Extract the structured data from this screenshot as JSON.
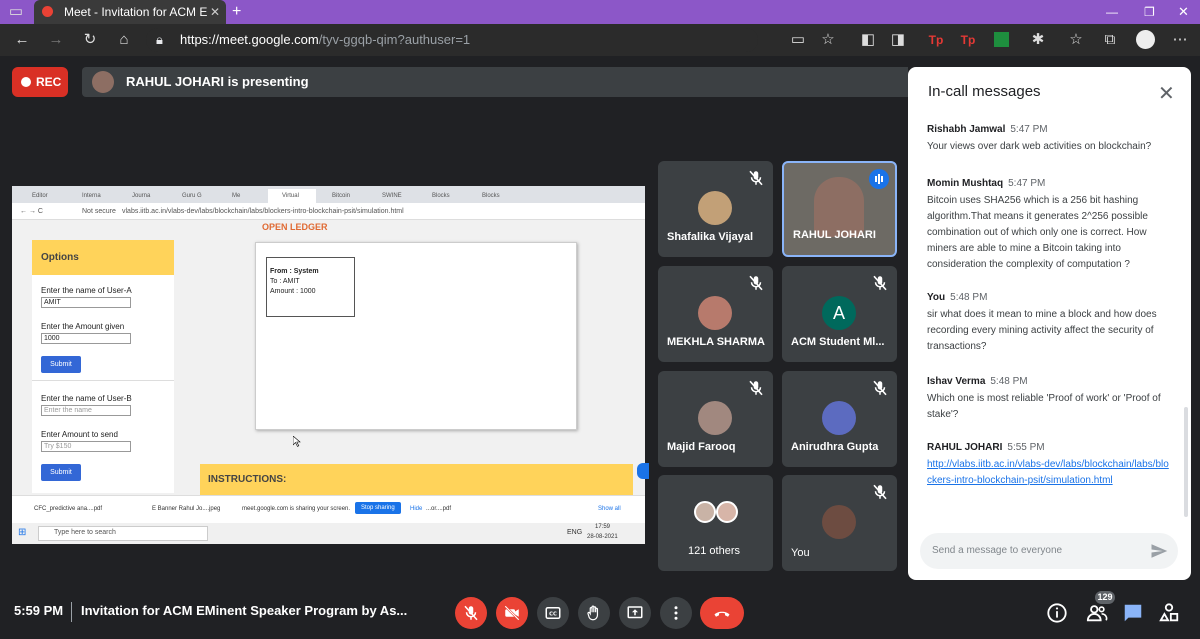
{
  "browser": {
    "tab_title": "Meet - Invitation for ACM E",
    "url_prefix": "https://meet.google.com",
    "url_path": "/tyv-ggqb-qim?authuser=1"
  },
  "meet": {
    "rec_label": "REC",
    "presenting_text": "RAHUL JOHARI is presenting",
    "time": "5:59 PM",
    "meeting_title": "Invitation for ACM EMinent Speaker Program by As...",
    "people_count": "129"
  },
  "shared_screen": {
    "tabs": [
      "Editor",
      "Interna",
      "Journa",
      "Guru G",
      "Me",
      "Virtual",
      "Bitcoin",
      "SWINE",
      "Blocks",
      "Blocks"
    ],
    "url": "vlabs.iitb.ac.in/vlabs-dev/labs/blockchain/labs/blockers-intro-blockchain-psit/simulation.html",
    "not_secure": "Not secure",
    "options_header": "Options",
    "label_user_a": "Enter the name of User-A",
    "value_user_a": "AMIT",
    "label_amount_given": "Enter the Amount given",
    "value_amount_given": "1000",
    "submit": "Submit",
    "label_user_b": "Enter the name of User-B",
    "placeholder_user_b": "Enter the name",
    "label_amount_send": "Enter Amount to send",
    "placeholder_amount_send": "Try $150",
    "ledger_title": "OPEN LEDGER",
    "ledger_from": "From : System",
    "ledger_to": "To : AMIT",
    "ledger_amount": "Amount : 1000",
    "instructions": "INSTRUCTIONS:",
    "download1": "CFC_predictive ana....pdf",
    "download2": "E Banner Rahul Jo....jpeg",
    "sharing_text": "meet.google.com is sharing your screen.",
    "stop_sharing": "Stop sharing",
    "hide": "Hide",
    "download3": "...or....pdf",
    "show_all": "Show all",
    "search_placeholder": "Type here to search",
    "lang": "ENG",
    "taskbar_time": "17:59",
    "taskbar_date": "28-08-2021"
  },
  "participants": [
    {
      "name": "Shafalika Vijayal",
      "muted": true,
      "avatar_color": "#c2a077"
    },
    {
      "name": "RAHUL JOHARI",
      "muted": false,
      "avatar_color": "#8d6e63"
    },
    {
      "name": "MEKHLA SHARMA",
      "muted": true,
      "avatar_color": "#b77a6c"
    },
    {
      "name": "ACM Student Ml...",
      "muted": true,
      "initial": "A",
      "avatar_color": "#00695c"
    },
    {
      "name": "Majid Farooq",
      "muted": true,
      "avatar_color": "#a1887f"
    },
    {
      "name": "Anirudhra Gupta",
      "muted": true,
      "avatar_color": "#5c6bc0"
    },
    {
      "name": "121 others",
      "muted": false,
      "avatar_color": "#9e9e9e"
    },
    {
      "name": "You",
      "muted": true,
      "avatar_color": "#6d4c41"
    }
  ],
  "chat": {
    "title": "In-call messages",
    "messages": [
      {
        "sender": "Rishabh Jamwal",
        "time": "5:47 PM",
        "text": "Your views over dark web activities on blockchain?"
      },
      {
        "sender": "Momin Mushtaq",
        "time": "5:47 PM",
        "text": "Bitcoin uses SHA256 which is a 256 bit hashing algorithm.That means it generates  2^256 possible combination out of which only one is correct. How miners are able to mine a Bitcoin taking into consideration the complexity of computation ?"
      },
      {
        "sender": "You",
        "time": "5:48 PM",
        "text": "sir what does it mean to mine a block and how does recording every mining activity affect the security of transactions?"
      },
      {
        "sender": "Ishav Verma",
        "time": "5:48 PM",
        "text": "Which one is most reliable 'Proof of work' or 'Proof of stake'?"
      },
      {
        "sender": "RAHUL JOHARI",
        "time": "5:55 PM",
        "text": "http://vlabs.iitb.ac.in/vlabs-dev/labs/blockchain/labs/blockers-intro-blockchain-psit/simulation.html"
      }
    ],
    "input_placeholder": "Send a message to everyone"
  },
  "colors": {
    "accent": "#8c57c8",
    "danger": "#ea4335",
    "link": "#1a73e8",
    "background": "#202124"
  }
}
